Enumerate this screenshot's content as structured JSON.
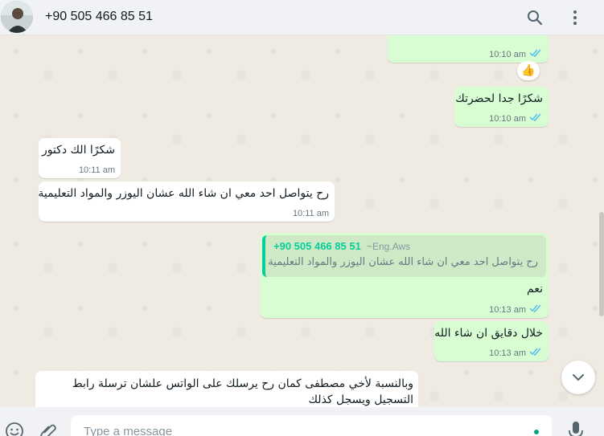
{
  "header": {
    "contact_name": "+90 505 466 85 51",
    "icons": [
      "search-icon",
      "menu-icon"
    ]
  },
  "messages": [
    {
      "dir": "out",
      "text": "",
      "time": "10:10 am",
      "ticks": "read"
    },
    {
      "dir": "out",
      "text": "شكرًا جدا لحضرتك",
      "time": "10:10 am",
      "ticks": "read"
    },
    {
      "dir": "in",
      "text": "شكرًا الك دكتور",
      "time": "10:11 am"
    },
    {
      "dir": "in",
      "text": "رح يتواصل احد معي ان شاء الله عشان اليوزر والمواد التعليمية",
      "time": "10:11 am"
    },
    {
      "dir": "out",
      "quote": {
        "author": "+90 505 466 85 51",
        "pushname": "~Eng.Aws",
        "text": "رح يتواصل احد معي ان شاء الله عشان اليوزر والمواد التعليمية"
      },
      "text": "نعم",
      "time": "10:13 am",
      "ticks": "read"
    },
    {
      "dir": "out",
      "text": "خلال دقايق ان شاء الله",
      "time": "10:13 am",
      "ticks": "read"
    },
    {
      "dir": "in",
      "text_line1": "وبالنسبة لأخي مصطفى كمان رح يرسلك على الواتس علشان ترسلة رابط",
      "text_line2": "التسجيل ويسجل كذلك"
    }
  ],
  "reaction": "👍",
  "composer": {
    "placeholder": "Type a message",
    "icons": [
      "emoji-icon",
      "attach-icon",
      "mic-icon"
    ]
  },
  "colors": {
    "outgoing": "#d9fdd3",
    "incoming": "#ffffff",
    "read_ticks": "#53bdeb",
    "accent": "#00a884"
  }
}
